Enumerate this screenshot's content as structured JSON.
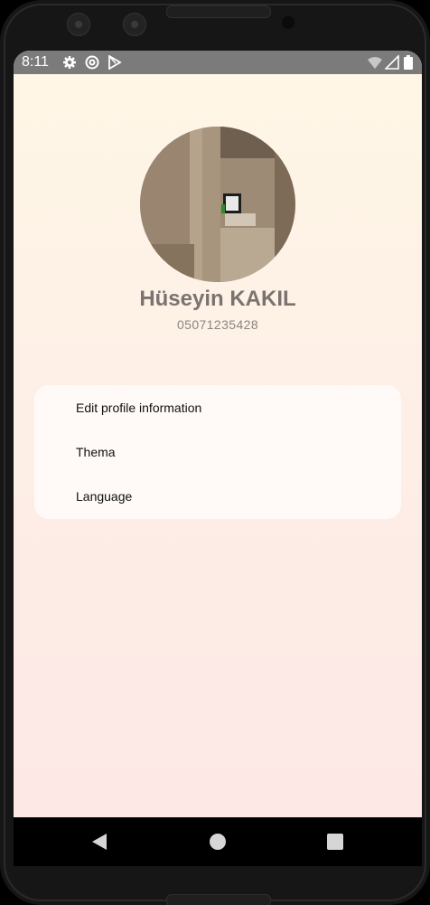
{
  "status_bar": {
    "time": "8:11",
    "icons": [
      "gear-icon",
      "sync-icon",
      "play-store-icon",
      "wifi-off-icon",
      "signal-icon",
      "battery-icon"
    ]
  },
  "profile": {
    "name": "Hüseyin KAKIL",
    "phone": "05071235428"
  },
  "menu": {
    "items": [
      {
        "label": "Edit profile information"
      },
      {
        "label": "Thema"
      },
      {
        "label": "Language"
      }
    ]
  },
  "nav": {
    "buttons": [
      "back-icon",
      "home-icon",
      "recents-icon"
    ]
  },
  "colors": {
    "gradient_top": "#fff7e6",
    "gradient_bottom": "#fde7e6",
    "status_bar": "#7b7b7b",
    "name_text": "#7a7370"
  }
}
